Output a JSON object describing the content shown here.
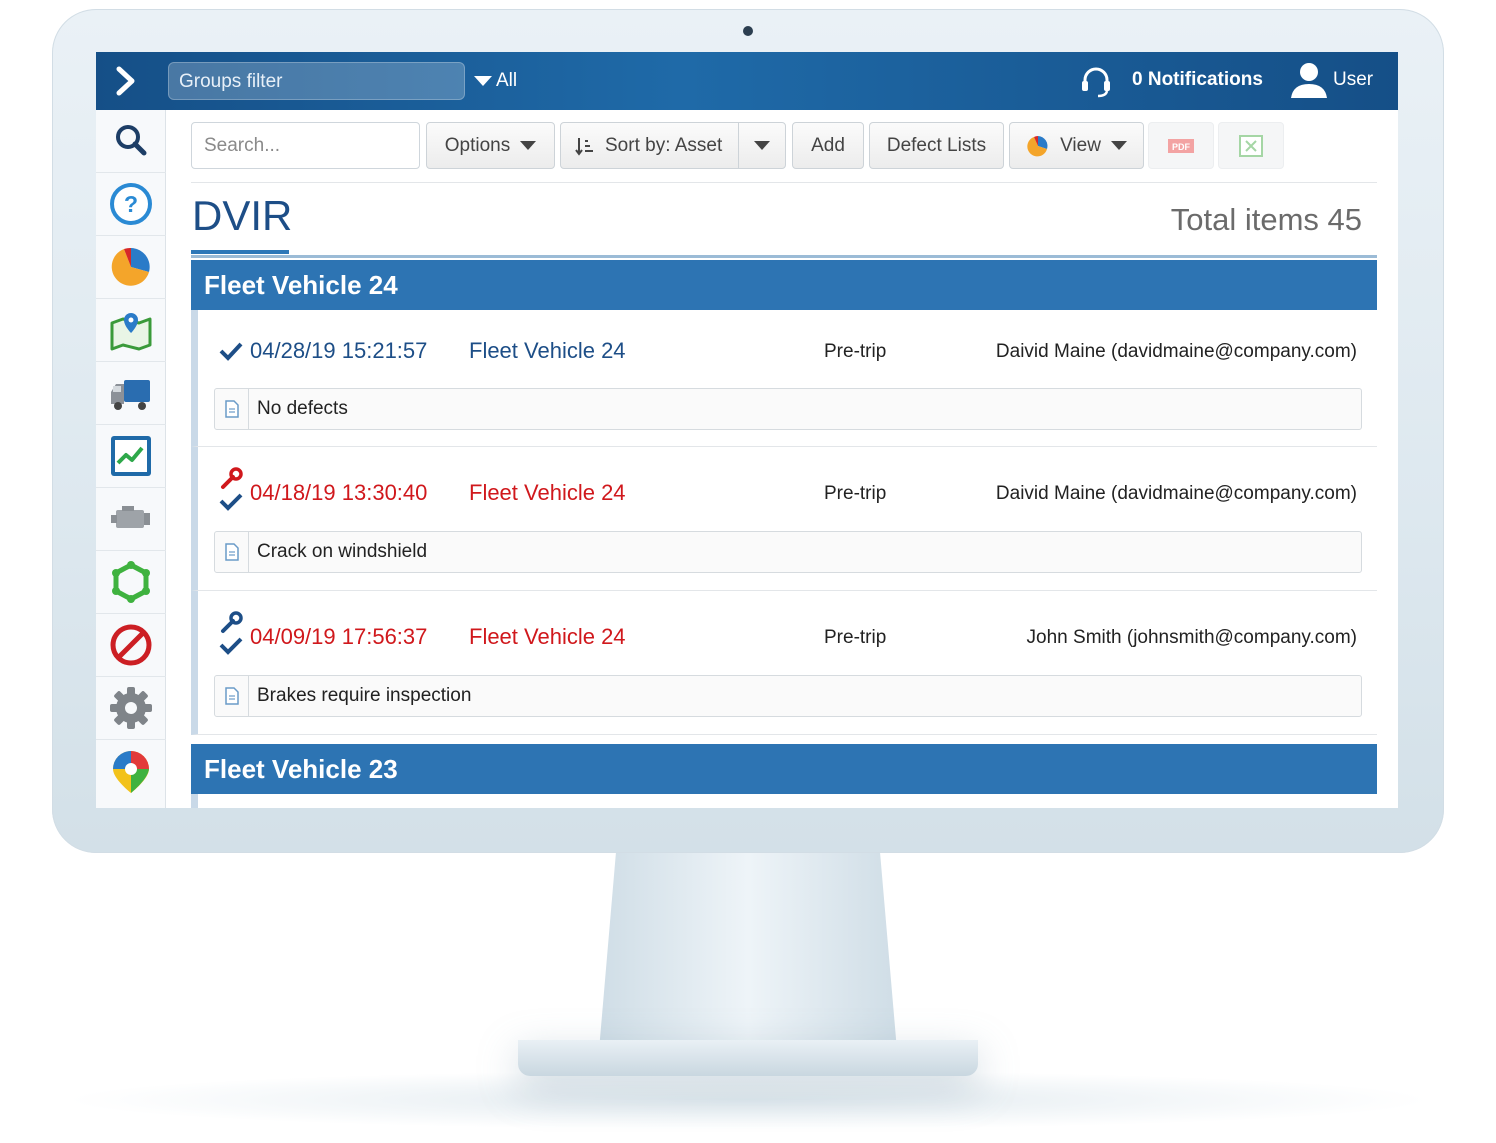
{
  "topbar": {
    "groups_filter_placeholder": "Groups filter",
    "groups_filter_value": "All",
    "notifications": "0 Notifications",
    "user": "User"
  },
  "sidebar": {
    "items": [
      {
        "icon": "search-icon"
      },
      {
        "icon": "help-icon"
      },
      {
        "icon": "dashboard-pie-icon"
      },
      {
        "icon": "map-icon"
      },
      {
        "icon": "truck-icon"
      },
      {
        "icon": "activity-chart-icon"
      },
      {
        "icon": "engine-icon"
      },
      {
        "icon": "zones-icon"
      },
      {
        "icon": "exceptions-icon"
      },
      {
        "icon": "settings-gear-icon"
      },
      {
        "icon": "marketplace-icon"
      }
    ]
  },
  "toolbar": {
    "search_placeholder": "Search...",
    "options_label": "Options",
    "sort_label": "Sort by: Asset",
    "add_label": "Add",
    "defect_lists_label": "Defect Lists",
    "view_label": "View",
    "pdf_label": "PDF"
  },
  "page": {
    "title": "DVIR",
    "total_items": "Total items 45"
  },
  "groups": [
    {
      "name": "Fleet Vehicle 24",
      "records": [
        {
          "datetime": "04/28/19 15:21:57",
          "vehicle": "Fleet Vehicle 24",
          "type": "Pre-trip",
          "driver": "Daivid Maine (davidmaine@company.com)",
          "note": "No defects",
          "status": "ok"
        },
        {
          "datetime": "04/18/19 13:30:40",
          "vehicle": "Fleet Vehicle 24",
          "type": "Pre-trip",
          "driver": "Daivid Maine (davidmaine@company.com)",
          "note": "Crack on windshield",
          "status": "defect-unrepaired"
        },
        {
          "datetime": "04/09/19 17:56:37",
          "vehicle": "Fleet Vehicle 24",
          "type": "Pre-trip",
          "driver": "John Smith (johnsmith@company.com)",
          "note": "Brakes require inspection",
          "status": "defect-repaired"
        }
      ]
    },
    {
      "name": "Fleet Vehicle 23",
      "records": []
    }
  ],
  "colors": {
    "topbar": "#1a5c98",
    "group_header": "#2d74b3",
    "title_blue": "#1d4e87",
    "defect_red": "#d0181c"
  }
}
